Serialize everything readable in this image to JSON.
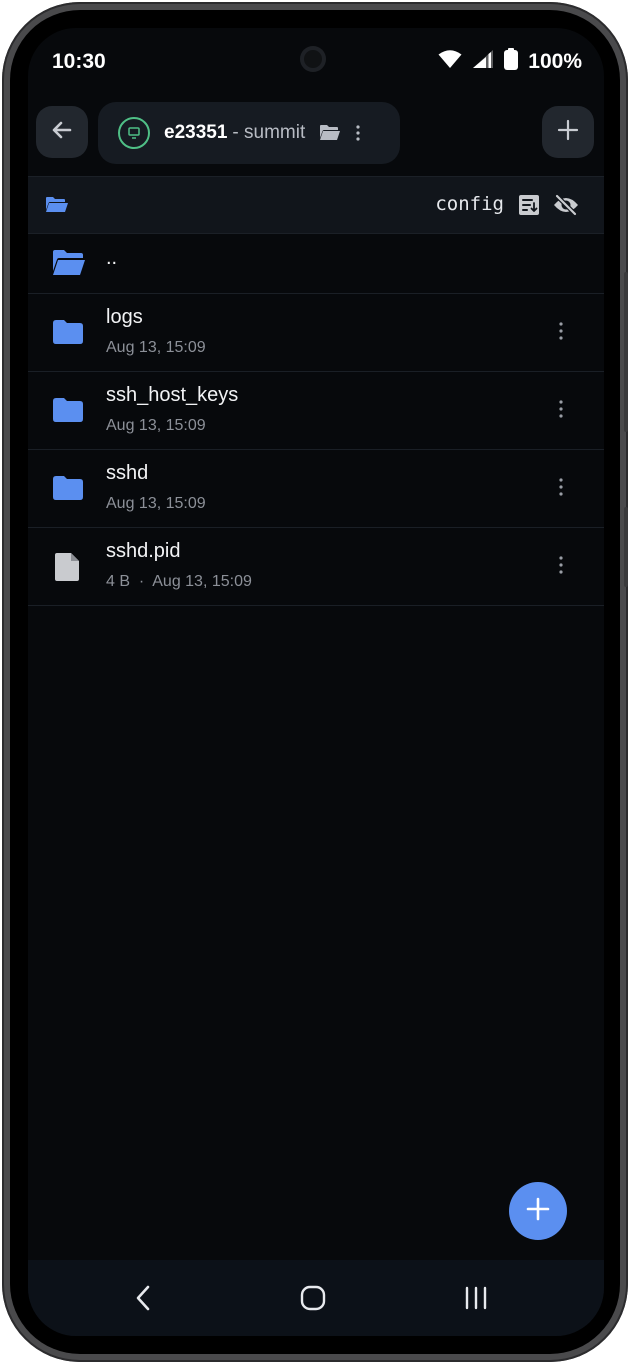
{
  "status_bar": {
    "time": "10:30",
    "battery_percent": "100%",
    "icons": [
      "wifi-icon",
      "cellular-signal-icon",
      "battery-icon"
    ]
  },
  "tab": {
    "title": "e23351",
    "subtitle": "- summit",
    "icons": [
      "host-icon",
      "folder-open-icon",
      "more-vertical-icon"
    ]
  },
  "path": {
    "current": "config",
    "icons": [
      "folder-open-icon",
      "sort-icon",
      "visibility-off-icon"
    ]
  },
  "files": {
    "parent": {
      "name": "..",
      "icon": "folder-open-icon"
    },
    "items": [
      {
        "name": "logs",
        "meta": "Aug 13, 15:09",
        "icon": "folder-icon"
      },
      {
        "name": "ssh_host_keys",
        "meta": "Aug 13, 15:09",
        "icon": "folder-icon"
      },
      {
        "name": "sshd",
        "meta": "Aug 13, 15:09",
        "icon": "folder-icon"
      },
      {
        "name": "sshd.pid",
        "meta": "4 B  ·  Aug 13, 15:09",
        "icon": "file-icon"
      }
    ]
  },
  "colors": {
    "accent": "#5b8ff0",
    "background": "#07090c",
    "folder": "#5b8ff0",
    "file": "#c9cbcf",
    "host_ring": "#4fbf86"
  }
}
